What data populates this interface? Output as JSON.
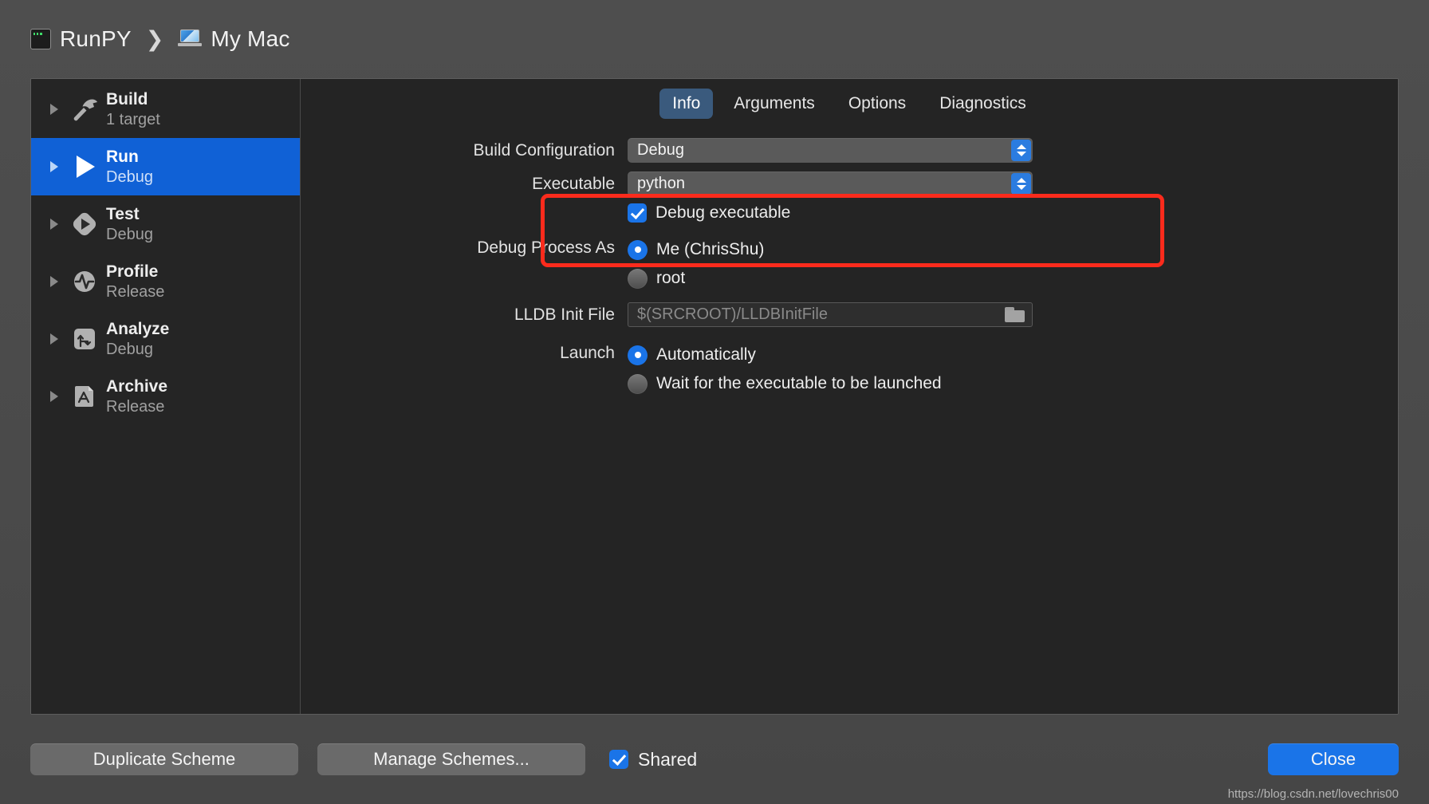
{
  "breadcrumb": {
    "scheme": "RunPY",
    "separator": "❯",
    "destination": "My Mac",
    "scheme_icon": "terminal-app-icon",
    "destination_icon": "macbook-icon"
  },
  "sidebar": {
    "items": [
      {
        "name": "Build",
        "sub": "1 target",
        "icon": "hammer-icon",
        "selected": false
      },
      {
        "name": "Run",
        "sub": "Debug",
        "icon": "play-icon",
        "selected": true
      },
      {
        "name": "Test",
        "sub": "Debug",
        "icon": "test-diamond-icon",
        "selected": false
      },
      {
        "name": "Profile",
        "sub": "Release",
        "icon": "pulse-circle-icon",
        "selected": false
      },
      {
        "name": "Analyze",
        "sub": "Debug",
        "icon": "analyze-arrows-icon",
        "selected": false
      },
      {
        "name": "Archive",
        "sub": "Release",
        "icon": "archive-appstore-icon",
        "selected": false
      }
    ]
  },
  "tabs": [
    {
      "label": "Info",
      "active": true
    },
    {
      "label": "Arguments",
      "active": false
    },
    {
      "label": "Options",
      "active": false
    },
    {
      "label": "Diagnostics",
      "active": false
    }
  ],
  "form": {
    "build_configuration": {
      "label": "Build Configuration",
      "value": "Debug"
    },
    "executable": {
      "label": "Executable",
      "value": "python",
      "debug_executable_label": "Debug executable",
      "debug_executable_checked": true
    },
    "debug_process_as": {
      "label": "Debug Process As",
      "options": [
        {
          "label": "Me (ChrisShu)",
          "selected": true
        },
        {
          "label": "root",
          "selected": false
        }
      ]
    },
    "lldb_init_file": {
      "label": "LLDB Init File",
      "value": "",
      "placeholder": "$(SRCROOT)/LLDBInitFile",
      "browse_icon": "folder-icon"
    },
    "launch": {
      "label": "Launch",
      "options": [
        {
          "label": "Automatically",
          "selected": true
        },
        {
          "label": "Wait for the executable to be launched",
          "selected": false
        }
      ]
    }
  },
  "footer": {
    "duplicate_scheme": "Duplicate Scheme",
    "manage_schemes": "Manage Schemes...",
    "shared_label": "Shared",
    "shared_checked": true,
    "close": "Close"
  },
  "watermark": "https://blog.csdn.net/lovechris00",
  "colors": {
    "accent_blue": "#1a74e8",
    "selection_blue": "#1061d6",
    "tab_active_bg": "#3a5a7d",
    "annotation_red": "#fb2b1c",
    "panel_bg": "#242424",
    "window_bg": "#4a4a4a"
  }
}
